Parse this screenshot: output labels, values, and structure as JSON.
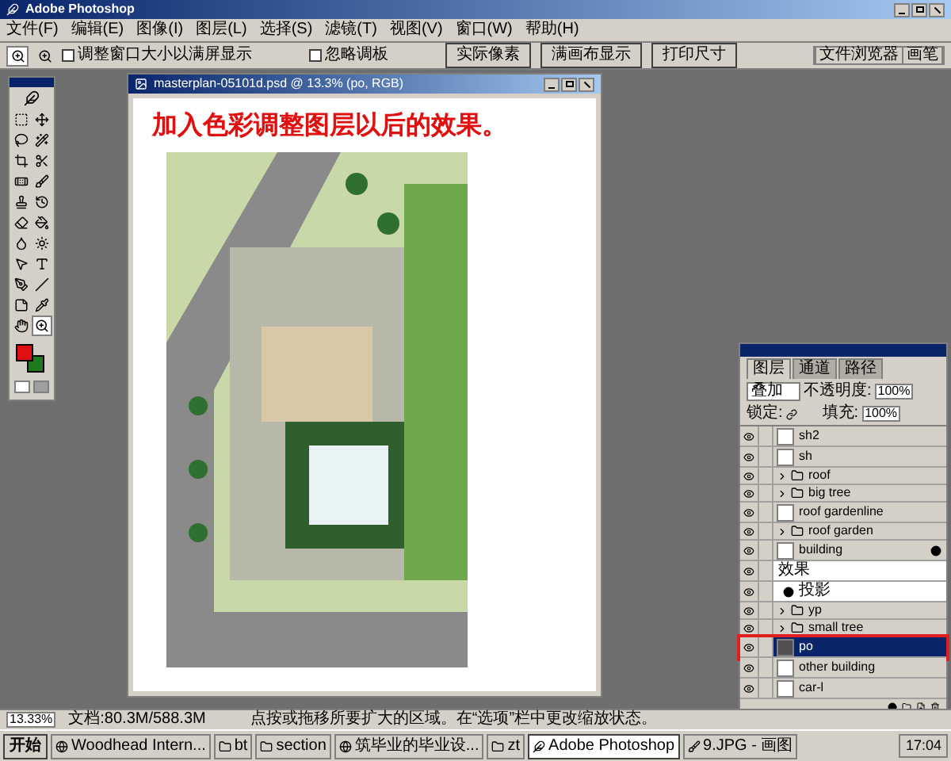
{
  "app": {
    "title": "Adobe Photoshop"
  },
  "menu": [
    "文件(F)",
    "编辑(E)",
    "图像(I)",
    "图层(L)",
    "选择(S)",
    "滤镜(T)",
    "视图(V)",
    "窗口(W)",
    "帮助(H)"
  ],
  "options_bar": {
    "checkboxes": [
      {
        "label": "调整窗口大小以满屏显示",
        "checked": false
      },
      {
        "label": "忽略调板",
        "checked": false
      }
    ],
    "buttons": [
      "实际像素",
      "满画布显示",
      "打印尺寸"
    ]
  },
  "palette_well": {
    "tabs": [
      "文件浏览器",
      "画笔"
    ]
  },
  "toolbox": {
    "tools": [
      {
        "kind": "marquee",
        "selected": false
      },
      {
        "kind": "move",
        "selected": false
      },
      {
        "kind": "lasso",
        "selected": false
      },
      {
        "kind": "wand",
        "selected": false
      },
      {
        "kind": "crop",
        "selected": false
      },
      {
        "kind": "slice",
        "selected": false
      },
      {
        "kind": "heal",
        "selected": false
      },
      {
        "kind": "brush",
        "selected": false
      },
      {
        "kind": "stamp",
        "selected": false
      },
      {
        "kind": "history",
        "selected": false
      },
      {
        "kind": "eraser",
        "selected": false
      },
      {
        "kind": "bucket",
        "selected": false
      },
      {
        "kind": "blur",
        "selected": false
      },
      {
        "kind": "dodge",
        "selected": false
      },
      {
        "kind": "select",
        "selected": false
      },
      {
        "kind": "type",
        "selected": false
      },
      {
        "kind": "pen",
        "selected": false
      },
      {
        "kind": "line",
        "selected": false
      },
      {
        "kind": "notes",
        "selected": false
      },
      {
        "kind": "eyedropper",
        "selected": false
      },
      {
        "kind": "hand",
        "selected": false
      },
      {
        "kind": "zoom",
        "selected": true
      }
    ]
  },
  "document": {
    "title": "masterplan-05101d.psd @ 13.3% (po, RGB)",
    "caption": "加入色彩调整图层以后的效果。"
  },
  "layers_panel": {
    "tabs": [
      {
        "label": "图层",
        "selected": true
      },
      {
        "label": "通道",
        "selected": false
      },
      {
        "label": "路径",
        "selected": false
      }
    ],
    "blend_mode": "叠加",
    "opacity_label": "不透明度:",
    "opacity": "100%",
    "lock_label": "锁定:",
    "fill_label": "填充:",
    "fill": "100%",
    "layers": [
      {
        "name": "sh2",
        "kind": "layer",
        "visible": true,
        "selected": false,
        "highlighted": false
      },
      {
        "name": "sh",
        "kind": "layer",
        "visible": true,
        "selected": false,
        "highlighted": false
      },
      {
        "name": "roof",
        "kind": "group",
        "visible": true,
        "selected": false,
        "highlighted": false
      },
      {
        "name": "big tree",
        "kind": "group",
        "visible": true,
        "selected": false,
        "highlighted": false
      },
      {
        "name": "roof gardenline",
        "kind": "layer",
        "visible": true,
        "selected": false,
        "highlighted": false
      },
      {
        "name": "roof garden",
        "kind": "group",
        "visible": true,
        "selected": false,
        "highlighted": false
      },
      {
        "name": "building",
        "kind": "layer",
        "visible": true,
        "selected": false,
        "highlighted": false,
        "effects": true
      },
      {
        "name": "效果",
        "kind": "effects",
        "visible": true,
        "selected": false,
        "highlighted": false
      },
      {
        "name": "投影",
        "kind": "effect",
        "visible": true,
        "selected": false,
        "highlighted": false
      },
      {
        "name": "yp",
        "kind": "group",
        "visible": true,
        "selected": false,
        "highlighted": false
      },
      {
        "name": "small tree",
        "kind": "group",
        "visible": true,
        "selected": false,
        "highlighted": false
      },
      {
        "name": "po",
        "kind": "layer",
        "visible": true,
        "selected": true,
        "highlighted": true
      },
      {
        "name": "other building",
        "kind": "layer",
        "visible": true,
        "selected": false,
        "highlighted": false
      },
      {
        "name": "car-l",
        "kind": "layer",
        "visible": true,
        "selected": false,
        "highlighted": false
      }
    ]
  },
  "status_bar": {
    "zoom": "13.33%",
    "doc_size": "文档:80.3M/588.3M",
    "hint": "点按或拖移所要扩大的区域。在“选项”栏中更改缩放状态。"
  },
  "taskbar": {
    "start": "开始",
    "tasks": [
      {
        "label": "Woodhead Intern...",
        "kind": "browser",
        "selected": false
      },
      {
        "label": "bt",
        "kind": "folder",
        "selected": false
      },
      {
        "label": "section",
        "kind": "folder",
        "selected": false
      },
      {
        "label": "筑毕业的毕业设...",
        "kind": "browser",
        "selected": false
      },
      {
        "label": "zt",
        "kind": "folder",
        "selected": false
      },
      {
        "label": "Adobe Photoshop",
        "kind": "app",
        "selected": true
      },
      {
        "label": "9.JPG - 画图",
        "kind": "paint",
        "selected": false
      }
    ],
    "clock": "17:04"
  }
}
